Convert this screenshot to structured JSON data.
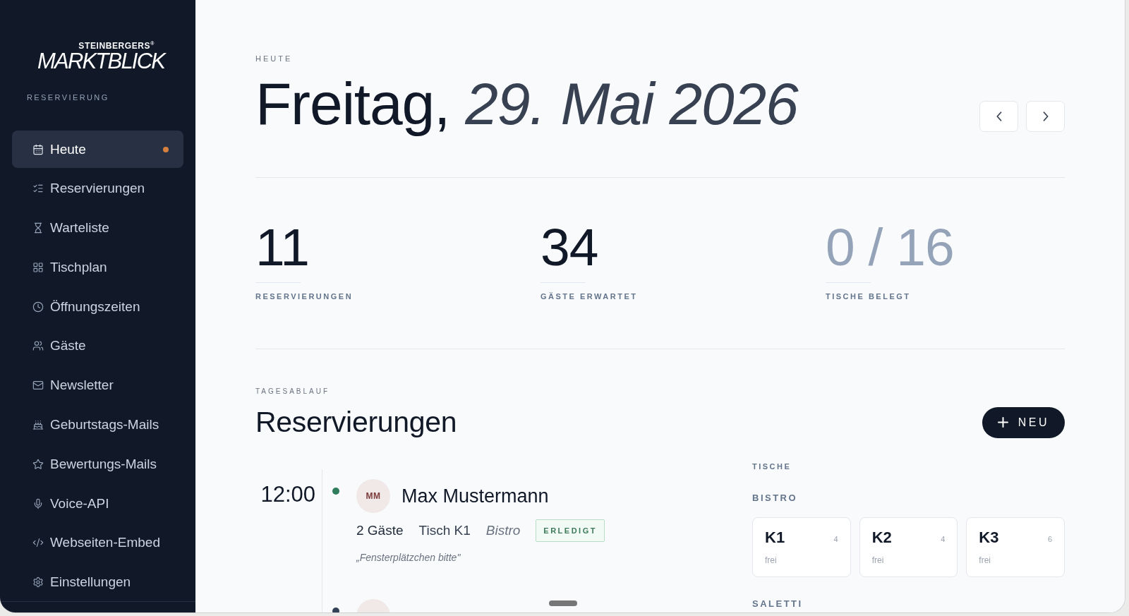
{
  "sidebar": {
    "logo": {
      "overline": "STEINBERGERS$^{®}$",
      "wordmark": "MARKTBLICK"
    },
    "section_label": "RESERVIERUNG",
    "items": [
      {
        "label": "Heute",
        "selected": true,
        "indicator": true
      },
      {
        "label": "Reservierungen",
        "selected": false,
        "indicator": false
      },
      {
        "label": "Warteliste",
        "selected": false,
        "indicator": false
      },
      {
        "label": "Tischplan",
        "selected": false,
        "indicator": false
      },
      {
        "label": "Öffnungszeiten",
        "selected": false,
        "indicator": false
      },
      {
        "label": "Gäste",
        "selected": false,
        "indicator": false
      },
      {
        "label": "Newsletter",
        "selected": false,
        "indicator": false
      },
      {
        "label": "Geburtstags-Mails",
        "selected": false,
        "indicator": false
      },
      {
        "label": "Bewertungs-Mails",
        "selected": false,
        "indicator": false
      },
      {
        "label": "Voice-API",
        "selected": false,
        "indicator": false
      },
      {
        "label": "Webseiten-Embed",
        "selected": false,
        "indicator": false
      },
      {
        "label": "Einstellungen",
        "selected": false,
        "indicator": false
      }
    ]
  },
  "header": {
    "eyebrow": "HEUTE",
    "title": "Freitag, *29. Mai 2026*"
  },
  "stats": [
    {
      "value": "11",
      "label": "RESERVIERUNGEN",
      "muted": false
    },
    {
      "value": "34",
      "label": "GÄSTE ERWARTET",
      "muted": false
    },
    {
      "value": "0 / 16",
      "label": "TISCHE BELEGT",
      "muted": true
    }
  ],
  "schedule": {
    "eyebrow": "TAGESABLAUF",
    "title": "Reservierungen",
    "new_button": "NEU",
    "reservations": [
      {
        "time": "12:00",
        "color": "#2f7d5b",
        "initials": "MM",
        "name": "Max Mustermann",
        "guests": "2 Gäste",
        "table": "Tisch K1",
        "area": "Bistro",
        "status": "ERLEDIGT",
        "note": "„Fensterplätzchen bitte\""
      },
      {
        "color": "#334155"
      }
    ]
  },
  "tables": {
    "label": "TISCHE",
    "areas": [
      {
        "name": "BISTRO",
        "tables": [
          {
            "name": "K1",
            "seats": "4",
            "status": "frei"
          },
          {
            "name": "K2",
            "seats": "4",
            "status": "frei"
          },
          {
            "name": "K3",
            "seats": "6",
            "status": "frei"
          }
        ]
      },
      {
        "name": "SALETTI"
      }
    ]
  }
}
